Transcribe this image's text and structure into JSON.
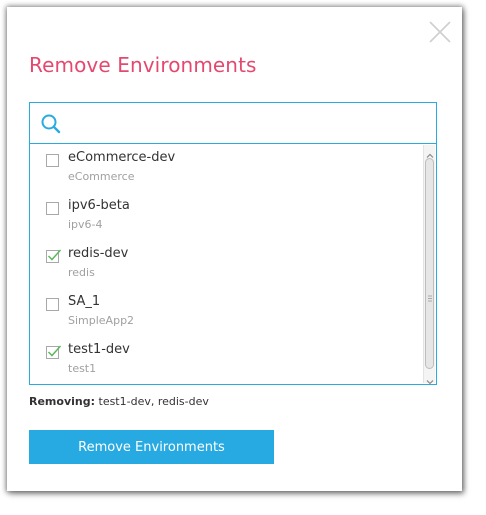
{
  "dialog": {
    "title": "Remove Environments",
    "close_icon": "close-icon"
  },
  "search": {
    "icon": "search-icon",
    "value": "",
    "placeholder": ""
  },
  "environments": [
    {
      "name": "eCommerce-dev",
      "app": "eCommerce",
      "checked": false
    },
    {
      "name": "ipv6-beta",
      "app": "ipv6-4",
      "checked": false
    },
    {
      "name": "redis-dev",
      "app": "redis",
      "checked": true
    },
    {
      "name": "SA_1",
      "app": "SimpleApp2",
      "checked": false
    },
    {
      "name": "test1-dev",
      "app": "test1",
      "checked": true
    }
  ],
  "summary": {
    "label": "Removing:",
    "value": "test1-dev, redis-dev"
  },
  "submit": {
    "label": "Remove Environments"
  },
  "colors": {
    "title": "#e5486e",
    "accent": "#29abe2",
    "button": "#27aae1",
    "check": "#5cb85c"
  }
}
